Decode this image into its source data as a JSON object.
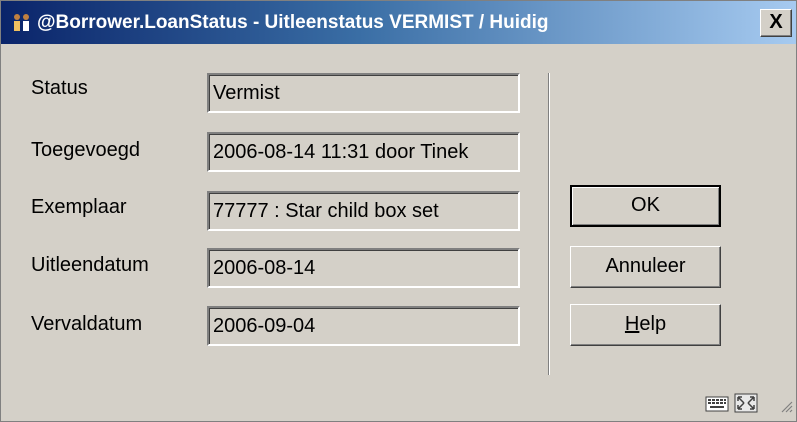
{
  "window": {
    "title": "@Borrower.LoanStatus - Uitleenstatus  VERMIST / Huidig",
    "close_label": "X"
  },
  "form": {
    "fields": [
      {
        "label": "Status",
        "value": "Vermist"
      },
      {
        "label": "Toegevoegd",
        "value": "2006-08-14 11:31 door Tinek"
      },
      {
        "label": "Exemplaar",
        "value": "77777 : Star child box set"
      },
      {
        "label": "Uitleendatum",
        "value": "2006-08-14"
      },
      {
        "label": "Vervaldatum",
        "value": "2006-09-04"
      }
    ]
  },
  "buttons": {
    "ok": "OK",
    "cancel": "Annuleer",
    "help_mnemonic": "H",
    "help_rest": "elp"
  },
  "icons": {
    "title": "users-icon",
    "keyboard": "keyboard-icon",
    "resize": "resize-icon",
    "grip": "size-grip-icon"
  }
}
